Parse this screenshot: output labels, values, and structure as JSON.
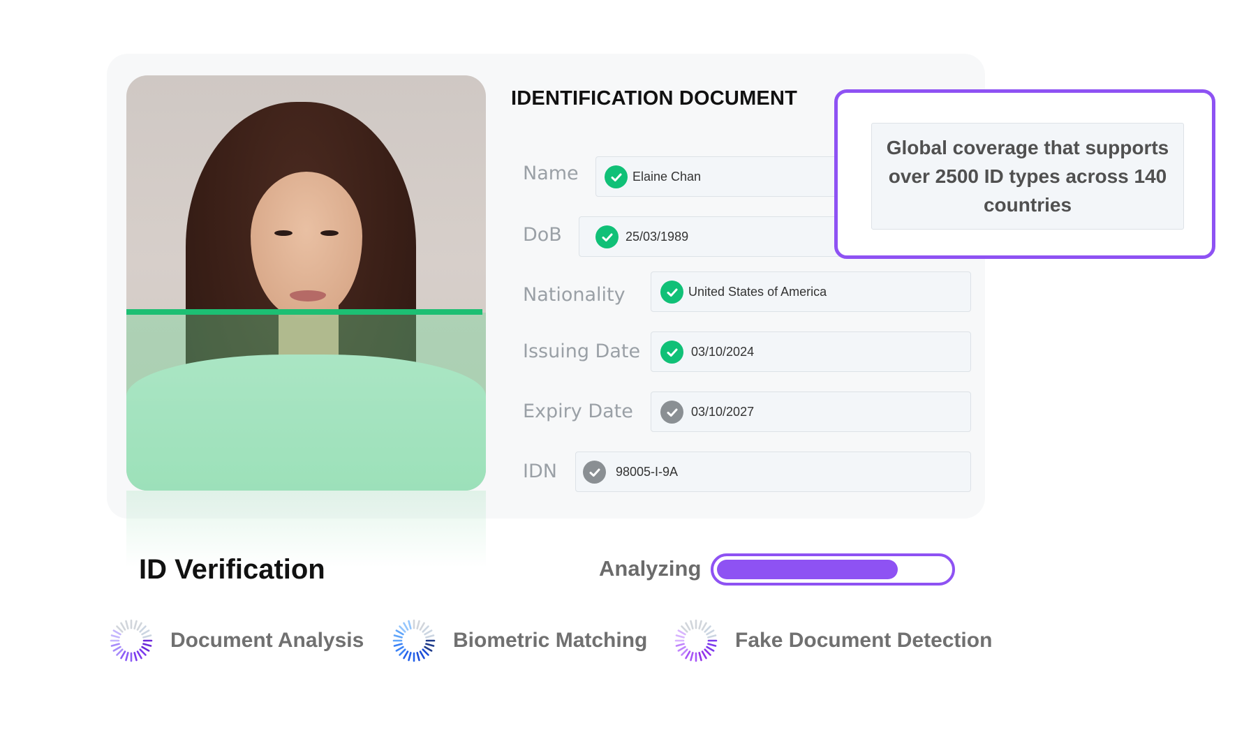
{
  "document": {
    "title": "IDENTIFICATION DOCUMENT",
    "fields": [
      {
        "label": "Name",
        "value": "Elaine Chan",
        "status": "verified"
      },
      {
        "label": "DoB",
        "value": "25/03/1989",
        "status": "verified"
      },
      {
        "label": "Nationality",
        "value": "United States of America",
        "status": "verified"
      },
      {
        "label": "Issuing Date",
        "value": "03/10/2024",
        "status": "verified"
      },
      {
        "label": "Expiry Date",
        "value": "03/10/2027",
        "status": "pending"
      },
      {
        "label": "IDN",
        "value": "98005-I-9A",
        "status": "pending"
      }
    ]
  },
  "callout": {
    "text": "Global coverage that supports over 2500 ID types across 140 countries"
  },
  "verification": {
    "title": "ID Verification",
    "status_label": "Analyzing",
    "progress": 0.78
  },
  "steps": [
    {
      "label": "Document Analysis",
      "icon": "spinner-icon"
    },
    {
      "label": "Biometric Matching",
      "icon": "spinner-icon"
    },
    {
      "label": "Fake Document Detection",
      "icon": "spinner-icon"
    }
  ],
  "colors": {
    "accent": "#8e52f3",
    "verified": "#10c077",
    "pending": "#8a8f93",
    "scan": "#1dbf73"
  }
}
